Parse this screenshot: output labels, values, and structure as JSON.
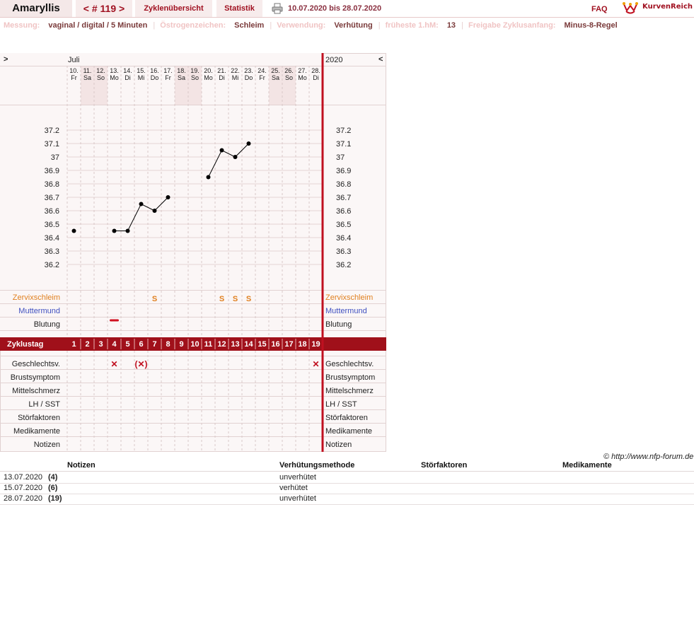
{
  "header": {
    "name": "Amaryllis",
    "cycle_nav": "< # 119 >",
    "overview_tab": "Zyklenübersicht",
    "stats_tab": "Statistik",
    "date_range": "10.07.2020 bis 28.07.2020",
    "faq": "FAQ",
    "logo": "KurvenReich"
  },
  "info": {
    "measure_label": "Messung:",
    "measure_value": "vaginal / digital / 5 Minuten",
    "estrogen_label": "Östrogenzeichen:",
    "estrogen_value": "Schleim",
    "usage_label": "Verwendung:",
    "usage_value": "Verhütung",
    "earliest_label": "früheste 1.hM:",
    "earliest_value": "13",
    "release_label": "Freigabe Zyklusanfang:",
    "release_value": "Minus-8-Regel"
  },
  "chart": {
    "nav_left": ">",
    "nav_right": "<",
    "month": "Juli",
    "year": "2020",
    "days": [
      {
        "d": "10.",
        "w": "Fr",
        "we": false
      },
      {
        "d": "11.",
        "w": "Sa",
        "we": true
      },
      {
        "d": "12.",
        "w": "So",
        "we": true
      },
      {
        "d": "13.",
        "w": "Mo",
        "we": false
      },
      {
        "d": "14.",
        "w": "Di",
        "we": false
      },
      {
        "d": "15.",
        "w": "Mi",
        "we": false
      },
      {
        "d": "16.",
        "w": "Do",
        "we": false
      },
      {
        "d": "17.",
        "w": "Fr",
        "we": false
      },
      {
        "d": "18.",
        "w": "Sa",
        "we": true
      },
      {
        "d": "19.",
        "w": "So",
        "we": true
      },
      {
        "d": "20.",
        "w": "Mo",
        "we": false
      },
      {
        "d": "21.",
        "w": "Di",
        "we": false
      },
      {
        "d": "22.",
        "w": "Mi",
        "we": false
      },
      {
        "d": "23.",
        "w": "Do",
        "we": false
      },
      {
        "d": "24.",
        "w": "Fr",
        "we": false
      },
      {
        "d": "25.",
        "w": "Sa",
        "we": true
      },
      {
        "d": "26.",
        "w": "So",
        "we": true
      },
      {
        "d": "27.",
        "w": "Mo",
        "we": false
      },
      {
        "d": "28.",
        "w": "Di",
        "we": false
      }
    ],
    "temp_ticks": [
      "37.2",
      "37.1",
      "37",
      "36.9",
      "36.8",
      "36.7",
      "36.6",
      "36.5",
      "36.4",
      "36.3",
      "36.2"
    ],
    "temps": [
      36.45,
      null,
      null,
      36.45,
      36.45,
      36.65,
      36.6,
      36.7,
      null,
      null,
      36.85,
      37.05,
      37.0,
      37.1,
      null,
      null,
      null,
      null,
      null
    ],
    "mucus_label": "Zervixschleim",
    "mucus": [
      "",
      "",
      "",
      "",
      "",
      "",
      "S",
      "",
      "",
      "",
      "",
      "S",
      "S",
      "S",
      "",
      "",
      "",
      "",
      ""
    ],
    "cervix_label": "Muttermund",
    "bleeding_label": "Blutung",
    "bleeding_day_index": 3,
    "cycle_label": "Zyklustag",
    "cycle_days": [
      "1",
      "2",
      "3",
      "4",
      "5",
      "6",
      "7",
      "8",
      "9",
      "10",
      "11",
      "12",
      "13",
      "14",
      "15",
      "16",
      "17",
      "18",
      "19"
    ],
    "sex_label": "Geschlechtsv.",
    "sex_marks": [
      {
        "i": 3,
        "t": "✕"
      },
      {
        "i": 5,
        "t": "(✕)"
      },
      {
        "i": 18,
        "t": "✕"
      }
    ],
    "rows_bottom": [
      "Brustsymptom",
      "Mittelschmerz",
      "LH / SST",
      "Störfaktoren",
      "Medikamente",
      "Notizen"
    ],
    "colors": {
      "accent": "#a0101a",
      "mucus": "#e08020",
      "cervix": "#4050c0",
      "weekend": "#f3e4e4"
    }
  },
  "copyright": "© http://www.nfp-forum.de",
  "notes": {
    "headers": [
      "Notizen",
      "Verhütungsmethode",
      "Störfaktoren",
      "Medikamente"
    ],
    "rows": [
      {
        "date": "13.07.2020",
        "day": "(4)",
        "method": "unverhütet"
      },
      {
        "date": "15.07.2020",
        "day": "(6)",
        "method": "verhütet"
      },
      {
        "date": "28.07.2020",
        "day": "(19)",
        "method": "unverhütet"
      }
    ]
  }
}
